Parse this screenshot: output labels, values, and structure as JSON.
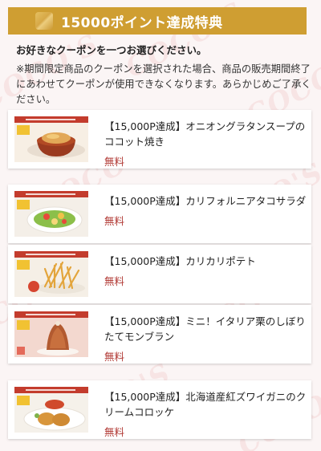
{
  "header": {
    "title": "15000ポイント達成特典"
  },
  "intro": {
    "lead": "お好きなクーポンを一つお選びください。",
    "note": "※期間限定商品のクーポンを選択された場合、商品の販売期間終了にあわせてクーポンが使用できなくなります。あらかじめご了承ください。"
  },
  "watermark": "COCO'S",
  "coupons": [
    {
      "name": "【15,000P達成】オニオングラタンスープのココット焼き",
      "price": "無料",
      "image": "onion-gratin-soup"
    },
    {
      "name": "【15,000P達成】カリフォルニアタコサラダ",
      "price": "無料",
      "image": "california-taco-salad"
    },
    {
      "name": "【15,000P達成】カリカリポテト",
      "price": "無料",
      "image": "crispy-fries"
    },
    {
      "name": "【15,000P達成】ミニ！イタリア栗のしぼりたてモンブラン",
      "price": "無料",
      "image": "mont-blanc"
    },
    {
      "name": "【15,000P達成】北海道産紅ズワイガニのクリームコロッケ",
      "price": "無料",
      "image": "crab-cream-croquette"
    }
  ],
  "colors": {
    "header": "#cf9e32",
    "price": "#b23a35",
    "banner": "#c33c2d",
    "background": "#fbf5f5"
  }
}
